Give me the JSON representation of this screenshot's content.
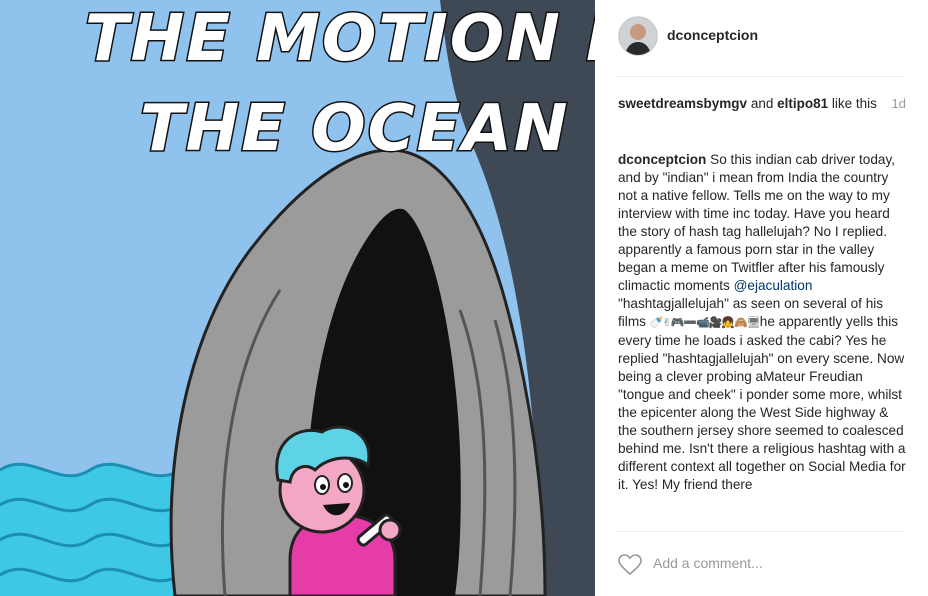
{
  "media": {
    "caption_lines": [
      "THE MOTION IN",
      "THE OCEAN"
    ]
  },
  "header": {
    "username": "dconceptcion"
  },
  "likes": {
    "user1": "sweetdreamsbymgv",
    "conjunction": " and ",
    "user2": "eltipo81",
    "suffix": " like this",
    "time_ago": "1d"
  },
  "post": {
    "author": "dconceptcion",
    "text_part1": "So this indian cab driver today, and by \"indian\" i mean from India the country not a native fellow. Tells me on the way to my interview with time inc today. Have you heard the story of hash tag hallelujah? No I replied. apparently a famous porn star in the valley began a meme on Twitfler after his famously climactic moments ",
    "mention": "@ejaculation",
    "text_part2": " \"hashtagjallelujah\" as seen on several of his films ",
    "emojis": "🍼✌🎮➖📹🎥👧🙈🖥",
    "text_part3": "he apparently yells this every time he loads i asked the cabi? Yes he replied \"hashtagjallelujah\" on every scene. Now being a clever probing aMateur Freudian \"tongue and cheek\" i ponder some more, whilst the epicenter along the West Side highway & the southern jersey shore seemed to coalesced behind me. Isn't there a religious hashtag with a different context all together on Social Media for it. Yes! My friend there"
  },
  "comment_box": {
    "placeholder": "Add a comment..."
  },
  "colors": {
    "sky": "#8fc3ee",
    "dark_panel": "#3f4955",
    "cave": "#9b9b9b",
    "waves": "#3fc7e6",
    "character_hair": "#5fd3e6",
    "character_shirt": "#e63ca8"
  }
}
